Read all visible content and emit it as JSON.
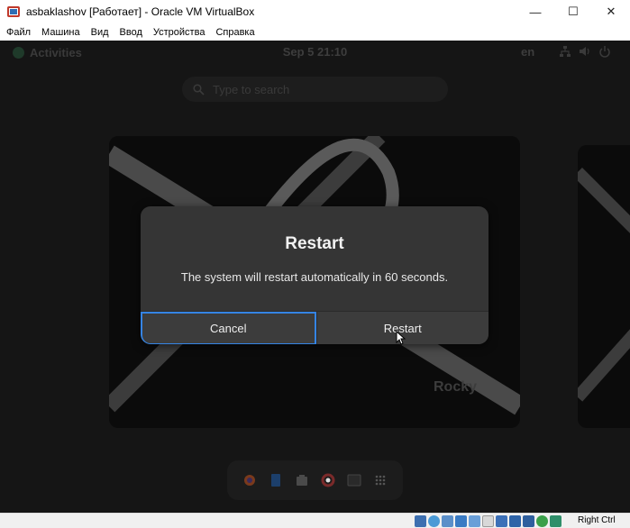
{
  "window": {
    "title": "asbaklashov [Работает] - Oracle VM VirtualBox",
    "minimize": "—",
    "maximize": "☐",
    "close": "✕"
  },
  "menu": {
    "items": [
      "Файл",
      "Машина",
      "Вид",
      "Ввод",
      "Устройства",
      "Справка"
    ]
  },
  "gnome": {
    "activities": "Activities",
    "clock": "Sep 5  21:10",
    "language": "en",
    "search_placeholder": "Type to search",
    "wallpaper_logo": "Rocky"
  },
  "dialog": {
    "title": "Restart",
    "message": "The system will restart automatically in 60 seconds.",
    "cancel_label": "Cancel",
    "restart_label": "Restart"
  },
  "statusbar": {
    "host_key": "Right Ctrl"
  },
  "colors": {
    "accent": "#3584e4",
    "dialog_bg": "#353535",
    "vm_bg": "#151515"
  }
}
